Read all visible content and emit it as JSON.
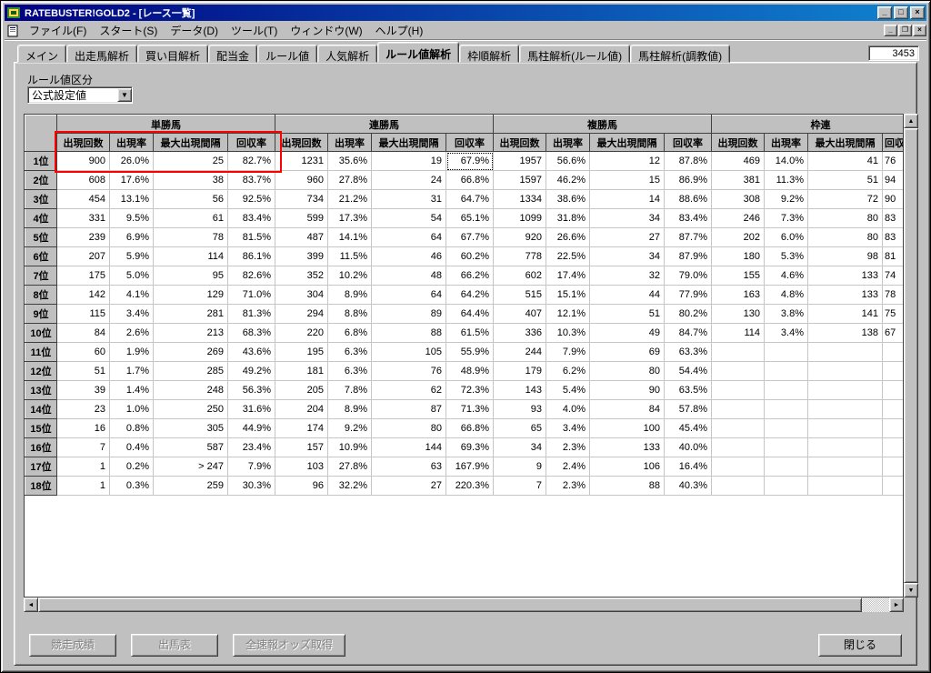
{
  "window": {
    "title": "RATEBUSTER!GOLD2 - [レース一覧]"
  },
  "icons": {
    "minimize": "_",
    "maximize": "□",
    "restore": "❐",
    "close": "×",
    "dropdown_arrow": "▼",
    "up": "▲",
    "down": "▼",
    "left": "◄",
    "right": "►"
  },
  "menu": {
    "items": [
      "ファイル(F)",
      "スタート(S)",
      "データ(D)",
      "ツール(T)",
      "ウィンドウ(W)",
      "ヘルプ(H)"
    ]
  },
  "tabs": {
    "items": [
      {
        "label": "メイン",
        "selected": false
      },
      {
        "label": "出走馬解析",
        "selected": false
      },
      {
        "label": "買い目解析",
        "selected": false
      },
      {
        "label": "配当金",
        "selected": false
      },
      {
        "label": "ルール値",
        "selected": false
      },
      {
        "label": "人気解析",
        "selected": false
      },
      {
        "label": "ルール値解析",
        "selected": true
      },
      {
        "label": "枠順解析",
        "selected": false
      },
      {
        "label": "馬柱解析(ルール値)",
        "selected": false
      },
      {
        "label": "馬柱解析(調教値)",
        "selected": false
      }
    ],
    "counter": "3453"
  },
  "filter": {
    "label": "ルール値区分",
    "dropdown_value": "公式設定値"
  },
  "table": {
    "groups": [
      "単勝馬",
      "連勝馬",
      "複勝馬",
      "枠連"
    ],
    "columns": [
      "出現回数",
      "出現率",
      "最大出現間隔",
      "回収率"
    ],
    "rows": [
      {
        "rank": "1位",
        "cells": [
          "900",
          "26.0%",
          "25",
          "82.7%",
          "1231",
          "35.6%",
          "19",
          "67.9%",
          "1957",
          "56.6%",
          "12",
          "87.8%",
          "469",
          "14.0%",
          "41",
          "76"
        ]
      },
      {
        "rank": "2位",
        "cells": [
          "608",
          "17.6%",
          "38",
          "83.7%",
          "960",
          "27.8%",
          "24",
          "66.8%",
          "1597",
          "46.2%",
          "15",
          "86.9%",
          "381",
          "11.3%",
          "51",
          "94"
        ]
      },
      {
        "rank": "3位",
        "cells": [
          "454",
          "13.1%",
          "56",
          "92.5%",
          "734",
          "21.2%",
          "31",
          "64.7%",
          "1334",
          "38.6%",
          "14",
          "88.6%",
          "308",
          "9.2%",
          "72",
          "90"
        ]
      },
      {
        "rank": "4位",
        "cells": [
          "331",
          "9.5%",
          "61",
          "83.4%",
          "599",
          "17.3%",
          "54",
          "65.1%",
          "1099",
          "31.8%",
          "34",
          "83.4%",
          "246",
          "7.3%",
          "80",
          "83"
        ]
      },
      {
        "rank": "5位",
        "cells": [
          "239",
          "6.9%",
          "78",
          "81.5%",
          "487",
          "14.1%",
          "64",
          "67.7%",
          "920",
          "26.6%",
          "27",
          "87.7%",
          "202",
          "6.0%",
          "80",
          "83"
        ]
      },
      {
        "rank": "6位",
        "cells": [
          "207",
          "5.9%",
          "114",
          "86.1%",
          "399",
          "11.5%",
          "46",
          "60.2%",
          "778",
          "22.5%",
          "34",
          "87.9%",
          "180",
          "5.3%",
          "98",
          "81"
        ]
      },
      {
        "rank": "7位",
        "cells": [
          "175",
          "5.0%",
          "95",
          "82.6%",
          "352",
          "10.2%",
          "48",
          "66.2%",
          "602",
          "17.4%",
          "32",
          "79.0%",
          "155",
          "4.6%",
          "133",
          "74"
        ]
      },
      {
        "rank": "8位",
        "cells": [
          "142",
          "4.1%",
          "129",
          "71.0%",
          "304",
          "8.9%",
          "64",
          "64.2%",
          "515",
          "15.1%",
          "44",
          "77.9%",
          "163",
          "4.8%",
          "133",
          "78"
        ]
      },
      {
        "rank": "9位",
        "cells": [
          "115",
          "3.4%",
          "281",
          "81.3%",
          "294",
          "8.8%",
          "89",
          "64.4%",
          "407",
          "12.1%",
          "51",
          "80.2%",
          "130",
          "3.8%",
          "141",
          "75"
        ]
      },
      {
        "rank": "10位",
        "cells": [
          "84",
          "2.6%",
          "213",
          "68.3%",
          "220",
          "6.8%",
          "88",
          "61.5%",
          "336",
          "10.3%",
          "49",
          "84.7%",
          "114",
          "3.4%",
          "138",
          "67"
        ]
      },
      {
        "rank": "11位",
        "cells": [
          "60",
          "1.9%",
          "269",
          "43.6%",
          "195",
          "6.3%",
          "105",
          "55.9%",
          "244",
          "7.9%",
          "69",
          "63.3%",
          "",
          "",
          "",
          ""
        ]
      },
      {
        "rank": "12位",
        "cells": [
          "51",
          "1.7%",
          "285",
          "49.2%",
          "181",
          "6.3%",
          "76",
          "48.9%",
          "179",
          "6.2%",
          "80",
          "54.4%",
          "",
          "",
          "",
          ""
        ]
      },
      {
        "rank": "13位",
        "cells": [
          "39",
          "1.4%",
          "248",
          "56.3%",
          "205",
          "7.8%",
          "62",
          "72.3%",
          "143",
          "5.4%",
          "90",
          "63.5%",
          "",
          "",
          "",
          ""
        ]
      },
      {
        "rank": "14位",
        "cells": [
          "23",
          "1.0%",
          "250",
          "31.6%",
          "204",
          "8.9%",
          "87",
          "71.3%",
          "93",
          "4.0%",
          "84",
          "57.8%",
          "",
          "",
          "",
          ""
        ]
      },
      {
        "rank": "15位",
        "cells": [
          "16",
          "0.8%",
          "305",
          "44.9%",
          "174",
          "9.2%",
          "80",
          "66.8%",
          "65",
          "3.4%",
          "100",
          "45.4%",
          "",
          "",
          "",
          ""
        ]
      },
      {
        "rank": "16位",
        "cells": [
          "7",
          "0.4%",
          "587",
          "23.4%",
          "157",
          "10.9%",
          "144",
          "69.3%",
          "34",
          "2.3%",
          "133",
          "40.0%",
          "",
          "",
          "",
          ""
        ]
      },
      {
        "rank": "17位",
        "cells": [
          "1",
          "0.2%",
          "> 247",
          "7.9%",
          "103",
          "27.8%",
          "63",
          "167.9%",
          "9",
          "2.4%",
          "106",
          "16.4%",
          "",
          "",
          "",
          ""
        ]
      },
      {
        "rank": "18位",
        "cells": [
          "1",
          "0.3%",
          "259",
          "30.3%",
          "96",
          "32.2%",
          "27",
          "220.3%",
          "7",
          "2.3%",
          "88",
          "40.3%",
          "",
          "",
          "",
          ""
        ]
      }
    ]
  },
  "buttons": {
    "race_results": "競走成績",
    "entry_table": "出馬表",
    "odds_fetch": "全速報オッズ取得",
    "close": "閉じる"
  },
  "colors": {
    "titlebar_start": "#000080",
    "titlebar_end": "#1084d0",
    "chrome": "#c0c0c0",
    "annotation": "#ff0000"
  }
}
